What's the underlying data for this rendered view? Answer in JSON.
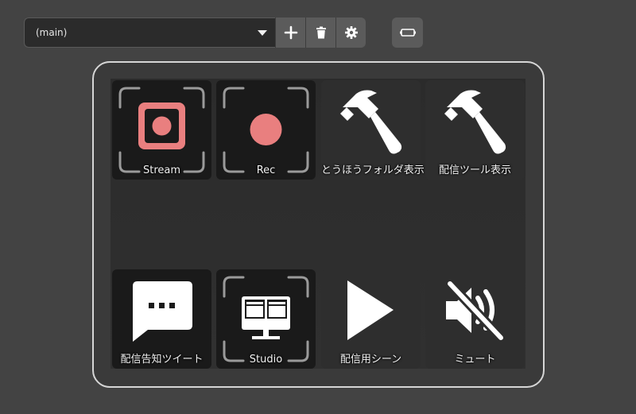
{
  "toolbar": {
    "profile_value": "(main)",
    "add_icon": "plus-icon",
    "delete_icon": "trash-icon",
    "settings_icon": "gear-icon",
    "device_icon": "stream-deck-icon"
  },
  "keys": [
    {
      "label": "Stream",
      "icon": "stream-icon"
    },
    {
      "label": "Rec",
      "icon": "record-icon"
    },
    {
      "label": "とうほうフォルダ表示",
      "icon": "hammer-icon"
    },
    {
      "label": "配信ツール表示",
      "icon": "hammer-icon"
    },
    {
      "label": "配信告知ツイート",
      "icon": "chat-bubble-icon"
    },
    {
      "label": "Studio",
      "icon": "studio-mode-icon"
    },
    {
      "label": "配信用シーン",
      "icon": "play-icon"
    },
    {
      "label": "ミュート",
      "icon": "mute-icon"
    }
  ],
  "colors": {
    "accent": "#e97f7f",
    "background": "#434343",
    "key_dark": "#1a1a1a"
  }
}
